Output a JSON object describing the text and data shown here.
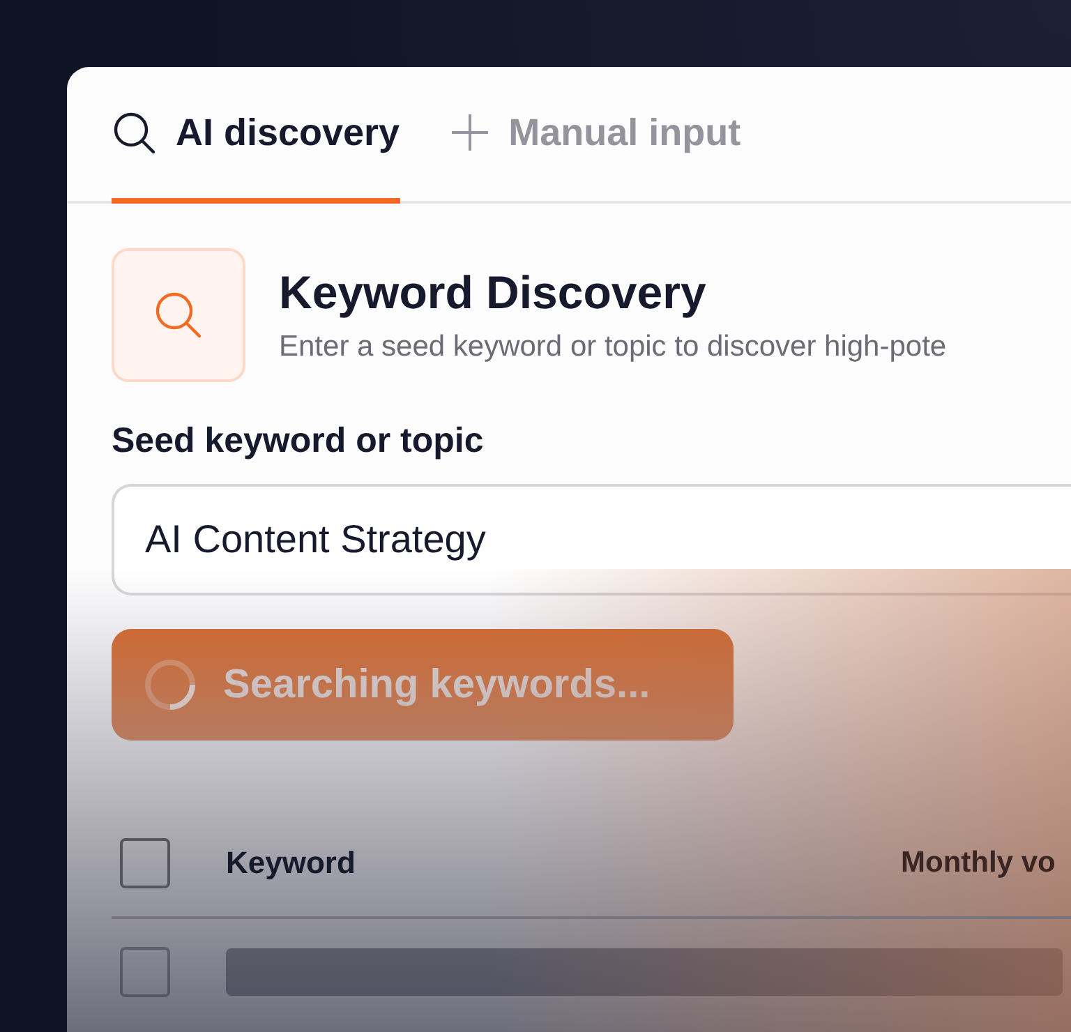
{
  "tabs": [
    {
      "label": "AI discovery",
      "kind": "search",
      "selected": true
    },
    {
      "label": "Manual input",
      "kind": "plus",
      "selected": false
    }
  ],
  "header": {
    "title": "Keyword Discovery",
    "subtitle": "Enter a seed keyword or topic to discover high-pote"
  },
  "seed_field": {
    "label": "Seed keyword or topic",
    "value": "AI Content Strategy"
  },
  "search_button": {
    "label": "Searching keywords...",
    "loading": true
  },
  "table": {
    "columns": [
      "Keyword",
      "Monthly vo"
    ],
    "header_checked": false,
    "rows": [
      {
        "checked": false
      }
    ]
  }
}
